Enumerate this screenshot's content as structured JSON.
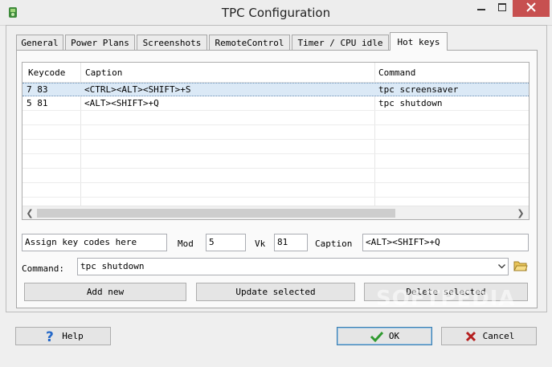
{
  "window": {
    "title": "TPC Configuration"
  },
  "tabs": [
    {
      "label": "General"
    },
    {
      "label": "Power Plans"
    },
    {
      "label": "Screenshots"
    },
    {
      "label": "RemoteControl"
    },
    {
      "label": "Timer / CPU idle"
    },
    {
      "label": "Hot keys",
      "active": true
    }
  ],
  "grid": {
    "headers": {
      "keycode": "Keycode",
      "caption": "Caption",
      "command": "Command"
    },
    "rows": [
      {
        "keycode": "7 83",
        "caption": "<CTRL><ALT><SHIFT>+S",
        "command": "tpc screensaver",
        "selected": true
      },
      {
        "keycode": "5 81",
        "caption": "<ALT><SHIFT>+Q",
        "command": "tpc shutdown",
        "selected": false
      }
    ]
  },
  "editor": {
    "assign_value": "Assign key codes here",
    "mod_label": "Mod",
    "mod_value": "5",
    "vk_label": "Vk",
    "vk_value": "81",
    "caption_label": "Caption",
    "caption_value": "<ALT><SHIFT>+Q",
    "command_label": "Command:",
    "command_value": "tpc shutdown"
  },
  "actions": {
    "add_new": "Add new",
    "update_selected": "Update selected",
    "delete_selected": "Delete selected"
  },
  "footer": {
    "help": "Help",
    "ok": "OK",
    "cancel": "Cancel"
  },
  "watermark": "SOFTPEDIA",
  "colors": {
    "close_button": "#c75050",
    "selection": "#dbe9f6",
    "ok_check": "#2f9a2f",
    "cancel_x": "#b52020",
    "help_icon": "#2468c8"
  }
}
